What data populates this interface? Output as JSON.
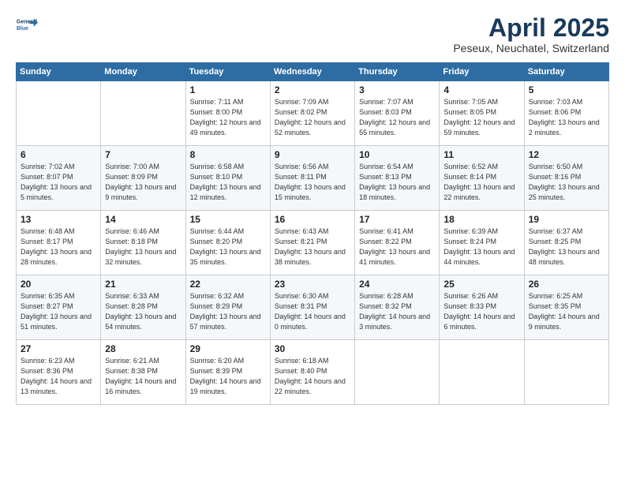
{
  "logo": {
    "line1": "General",
    "line2": "Blue"
  },
  "title": "April 2025",
  "subtitle": "Peseux, Neuchatel, Switzerland",
  "days_of_week": [
    "Sunday",
    "Monday",
    "Tuesday",
    "Wednesday",
    "Thursday",
    "Friday",
    "Saturday"
  ],
  "weeks": [
    [
      {
        "day": "",
        "detail": ""
      },
      {
        "day": "",
        "detail": ""
      },
      {
        "day": "1",
        "detail": "Sunrise: 7:11 AM\nSunset: 8:00 PM\nDaylight: 12 hours\nand 49 minutes."
      },
      {
        "day": "2",
        "detail": "Sunrise: 7:09 AM\nSunset: 8:02 PM\nDaylight: 12 hours\nand 52 minutes."
      },
      {
        "day": "3",
        "detail": "Sunrise: 7:07 AM\nSunset: 8:03 PM\nDaylight: 12 hours\nand 55 minutes."
      },
      {
        "day": "4",
        "detail": "Sunrise: 7:05 AM\nSunset: 8:05 PM\nDaylight: 12 hours\nand 59 minutes."
      },
      {
        "day": "5",
        "detail": "Sunrise: 7:03 AM\nSunset: 8:06 PM\nDaylight: 13 hours\nand 2 minutes."
      }
    ],
    [
      {
        "day": "6",
        "detail": "Sunrise: 7:02 AM\nSunset: 8:07 PM\nDaylight: 13 hours\nand 5 minutes."
      },
      {
        "day": "7",
        "detail": "Sunrise: 7:00 AM\nSunset: 8:09 PM\nDaylight: 13 hours\nand 9 minutes."
      },
      {
        "day": "8",
        "detail": "Sunrise: 6:58 AM\nSunset: 8:10 PM\nDaylight: 13 hours\nand 12 minutes."
      },
      {
        "day": "9",
        "detail": "Sunrise: 6:56 AM\nSunset: 8:11 PM\nDaylight: 13 hours\nand 15 minutes."
      },
      {
        "day": "10",
        "detail": "Sunrise: 6:54 AM\nSunset: 8:13 PM\nDaylight: 13 hours\nand 18 minutes."
      },
      {
        "day": "11",
        "detail": "Sunrise: 6:52 AM\nSunset: 8:14 PM\nDaylight: 13 hours\nand 22 minutes."
      },
      {
        "day": "12",
        "detail": "Sunrise: 6:50 AM\nSunset: 8:16 PM\nDaylight: 13 hours\nand 25 minutes."
      }
    ],
    [
      {
        "day": "13",
        "detail": "Sunrise: 6:48 AM\nSunset: 8:17 PM\nDaylight: 13 hours\nand 28 minutes."
      },
      {
        "day": "14",
        "detail": "Sunrise: 6:46 AM\nSunset: 8:18 PM\nDaylight: 13 hours\nand 32 minutes."
      },
      {
        "day": "15",
        "detail": "Sunrise: 6:44 AM\nSunset: 8:20 PM\nDaylight: 13 hours\nand 35 minutes."
      },
      {
        "day": "16",
        "detail": "Sunrise: 6:43 AM\nSunset: 8:21 PM\nDaylight: 13 hours\nand 38 minutes."
      },
      {
        "day": "17",
        "detail": "Sunrise: 6:41 AM\nSunset: 8:22 PM\nDaylight: 13 hours\nand 41 minutes."
      },
      {
        "day": "18",
        "detail": "Sunrise: 6:39 AM\nSunset: 8:24 PM\nDaylight: 13 hours\nand 44 minutes."
      },
      {
        "day": "19",
        "detail": "Sunrise: 6:37 AM\nSunset: 8:25 PM\nDaylight: 13 hours\nand 48 minutes."
      }
    ],
    [
      {
        "day": "20",
        "detail": "Sunrise: 6:35 AM\nSunset: 8:27 PM\nDaylight: 13 hours\nand 51 minutes."
      },
      {
        "day": "21",
        "detail": "Sunrise: 6:33 AM\nSunset: 8:28 PM\nDaylight: 13 hours\nand 54 minutes."
      },
      {
        "day": "22",
        "detail": "Sunrise: 6:32 AM\nSunset: 8:29 PM\nDaylight: 13 hours\nand 57 minutes."
      },
      {
        "day": "23",
        "detail": "Sunrise: 6:30 AM\nSunset: 8:31 PM\nDaylight: 14 hours\nand 0 minutes."
      },
      {
        "day": "24",
        "detail": "Sunrise: 6:28 AM\nSunset: 8:32 PM\nDaylight: 14 hours\nand 3 minutes."
      },
      {
        "day": "25",
        "detail": "Sunrise: 6:26 AM\nSunset: 8:33 PM\nDaylight: 14 hours\nand 6 minutes."
      },
      {
        "day": "26",
        "detail": "Sunrise: 6:25 AM\nSunset: 8:35 PM\nDaylight: 14 hours\nand 9 minutes."
      }
    ],
    [
      {
        "day": "27",
        "detail": "Sunrise: 6:23 AM\nSunset: 8:36 PM\nDaylight: 14 hours\nand 13 minutes."
      },
      {
        "day": "28",
        "detail": "Sunrise: 6:21 AM\nSunset: 8:38 PM\nDaylight: 14 hours\nand 16 minutes."
      },
      {
        "day": "29",
        "detail": "Sunrise: 6:20 AM\nSunset: 8:39 PM\nDaylight: 14 hours\nand 19 minutes."
      },
      {
        "day": "30",
        "detail": "Sunrise: 6:18 AM\nSunset: 8:40 PM\nDaylight: 14 hours\nand 22 minutes."
      },
      {
        "day": "",
        "detail": ""
      },
      {
        "day": "",
        "detail": ""
      },
      {
        "day": "",
        "detail": ""
      }
    ]
  ]
}
